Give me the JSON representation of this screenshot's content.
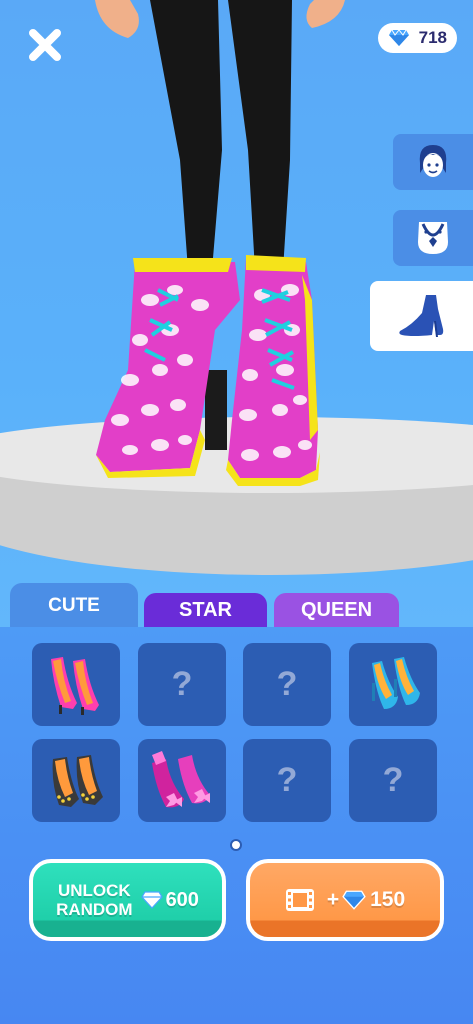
{
  "hud": {
    "close_icon": "close-icon",
    "gems": "718"
  },
  "categories": [
    {
      "name": "face",
      "icon": "face-icon",
      "active": false
    },
    {
      "name": "necklace",
      "icon": "necklace-icon",
      "active": false
    },
    {
      "name": "shoes",
      "icon": "high-heel-icon",
      "active": true
    }
  ],
  "tabs": [
    {
      "label": "CUTE",
      "active": true,
      "color": "#4b8ee6"
    },
    {
      "label": "STAR",
      "active": false,
      "color": "#6a2cd8"
    },
    {
      "label": "QUEEN",
      "active": false,
      "color": "#9a52e3"
    }
  ],
  "items": [
    {
      "id": "shoe-pink-pumps",
      "locked": false
    },
    {
      "id": "locked",
      "locked": true,
      "symbol": "?"
    },
    {
      "id": "locked",
      "locked": true,
      "symbol": "?"
    },
    {
      "id": "shoe-blue-peeptoe",
      "locked": false
    },
    {
      "id": "shoe-studded-heels",
      "locked": false
    },
    {
      "id": "shoe-pink-bow-heels",
      "locked": false
    },
    {
      "id": "locked",
      "locked": true,
      "symbol": "?"
    },
    {
      "id": "locked",
      "locked": true,
      "symbol": "?"
    }
  ],
  "actions": {
    "unlock_line1": "UNLOCK",
    "unlock_line2": "RANDOM",
    "unlock_cost": "600",
    "watch_prefix": "+",
    "watch_reward": "150"
  },
  "colors": {
    "accent_mint": "#1fcfa9",
    "accent_orange": "#ff9847",
    "panel_blue": "#4787f2",
    "slot_blue": "#2c5db3",
    "gem_blue": "#4aa7ff"
  }
}
